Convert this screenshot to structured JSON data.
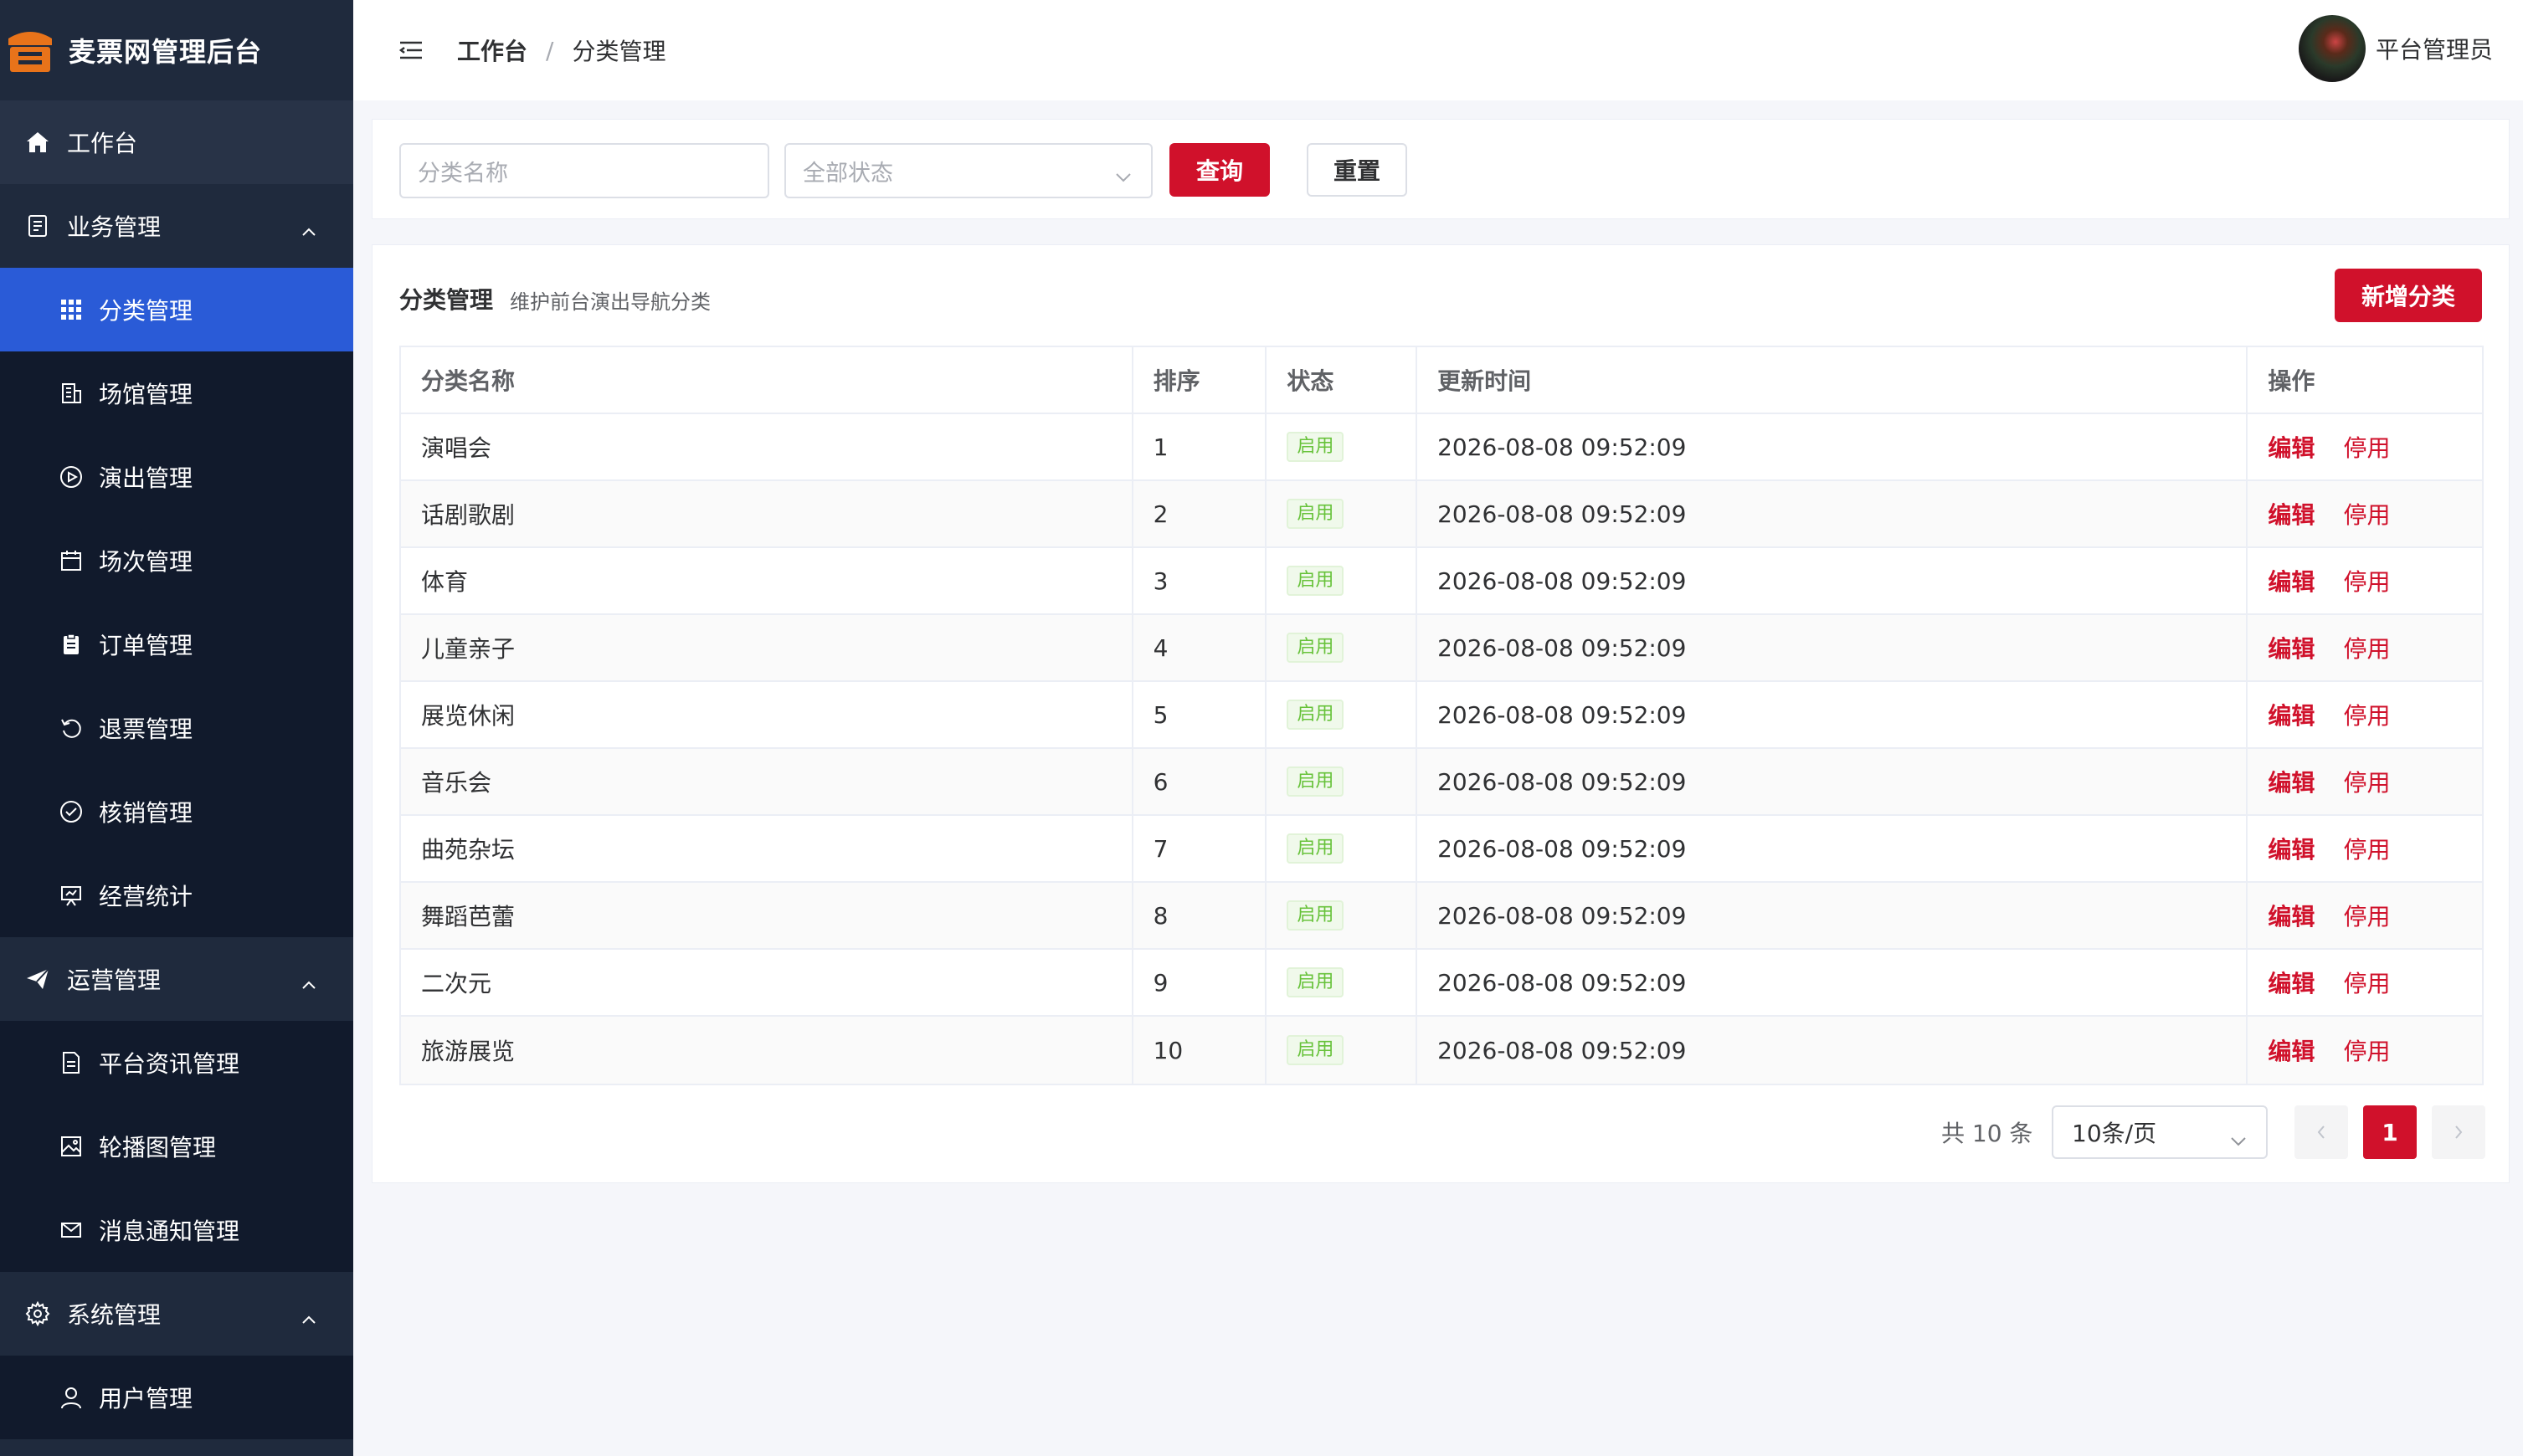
{
  "app": {
    "title": "麦票网管理后台"
  },
  "sidebar": {
    "workbench": "工作台",
    "groups": [
      {
        "label": "业务管理",
        "items": [
          "分类管理",
          "场馆管理",
          "演出管理",
          "场次管理",
          "订单管理",
          "退票管理",
          "核销管理",
          "经营统计"
        ]
      },
      {
        "label": "运营管理",
        "items": [
          "平台资讯管理",
          "轮播图管理",
          "消息通知管理"
        ]
      },
      {
        "label": "系统管理",
        "items": [
          "用户管理"
        ]
      }
    ],
    "selected": "分类管理"
  },
  "header": {
    "breadcrumb_home": "工作台",
    "breadcrumb_sep": "/",
    "breadcrumb_current": "分类管理",
    "user_name": "平台管理员"
  },
  "search": {
    "name_placeholder": "分类名称",
    "status_placeholder": "全部状态",
    "query_label": "查询",
    "reset_label": "重置"
  },
  "card": {
    "title": "分类管理",
    "subtitle": "维护前台演出导航分类",
    "add_label": "新增分类"
  },
  "table": {
    "headers": [
      "分类名称",
      "排序",
      "状态",
      "更新时间",
      "操作"
    ],
    "rows": [
      {
        "name": "演唱会",
        "sort": "1",
        "status": "启用",
        "updated": "2026-08-08 09:52:09"
      },
      {
        "name": "话剧歌剧",
        "sort": "2",
        "status": "启用",
        "updated": "2026-08-08 09:52:09"
      },
      {
        "name": "体育",
        "sort": "3",
        "status": "启用",
        "updated": "2026-08-08 09:52:09"
      },
      {
        "name": "儿童亲子",
        "sort": "4",
        "status": "启用",
        "updated": "2026-08-08 09:52:09"
      },
      {
        "name": "展览休闲",
        "sort": "5",
        "status": "启用",
        "updated": "2026-08-08 09:52:09"
      },
      {
        "name": "音乐会",
        "sort": "6",
        "status": "启用",
        "updated": "2026-08-08 09:52:09"
      },
      {
        "name": "曲苑杂坛",
        "sort": "7",
        "status": "启用",
        "updated": "2026-08-08 09:52:09"
      },
      {
        "name": "舞蹈芭蕾",
        "sort": "8",
        "status": "启用",
        "updated": "2026-08-08 09:52:09"
      },
      {
        "name": "二次元",
        "sort": "9",
        "status": "启用",
        "updated": "2026-08-08 09:52:09"
      },
      {
        "name": "旅游展览",
        "sort": "10",
        "status": "启用",
        "updated": "2026-08-08 09:52:09"
      }
    ],
    "edit_label": "编辑",
    "disable_label": "停用"
  },
  "pagination": {
    "total_text": "共 10 条",
    "page_size": "10条/页",
    "current_page": "1"
  },
  "colors": {
    "accent": "#d0112b",
    "sidebar": "#1f2a3d",
    "selected": "#2a5bd7",
    "tag_green": "#67c23a"
  }
}
